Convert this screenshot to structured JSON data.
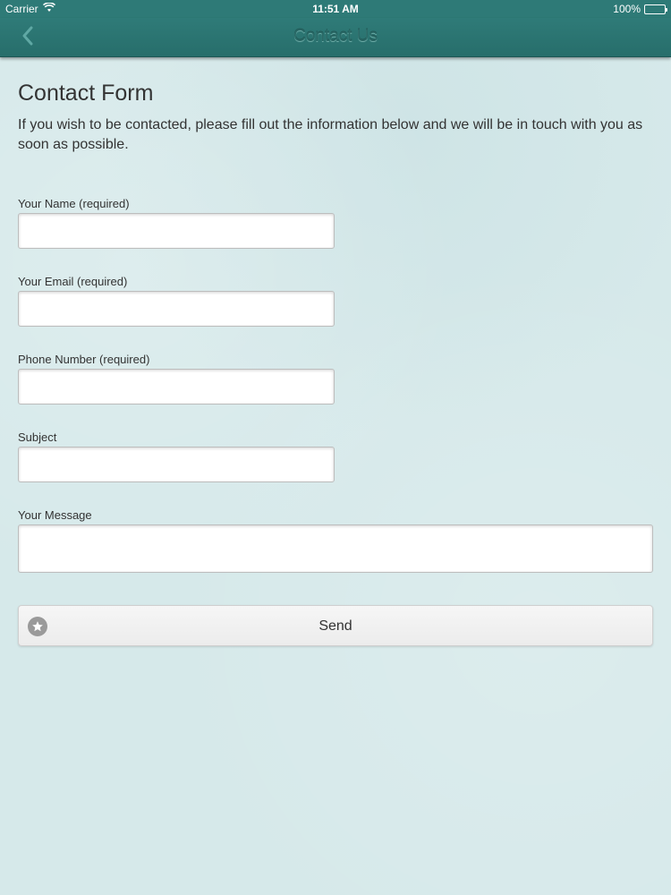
{
  "status_bar": {
    "carrier": "Carrier",
    "time": "11:51 AM",
    "battery": "100%"
  },
  "nav": {
    "title": "Contact Us",
    "back_icon": "chevron-left-icon"
  },
  "form": {
    "title": "Contact Form",
    "intro": "If you wish to be contacted, please fill out the information below and we will be in touch with you as soon as possible.",
    "fields": [
      {
        "label": "Your Name (required)",
        "value": ""
      },
      {
        "label": "Your Email (required)",
        "value": ""
      },
      {
        "label": "Phone Number (required)",
        "value": ""
      },
      {
        "label": "Subject",
        "value": ""
      }
    ],
    "message": {
      "label": "Your Message",
      "value": ""
    },
    "send": {
      "label": "Send",
      "icon": "star-icon"
    }
  },
  "colors": {
    "nav_bar": "#2e7a77",
    "background": "#d6e9ea",
    "text": "#333333"
  }
}
